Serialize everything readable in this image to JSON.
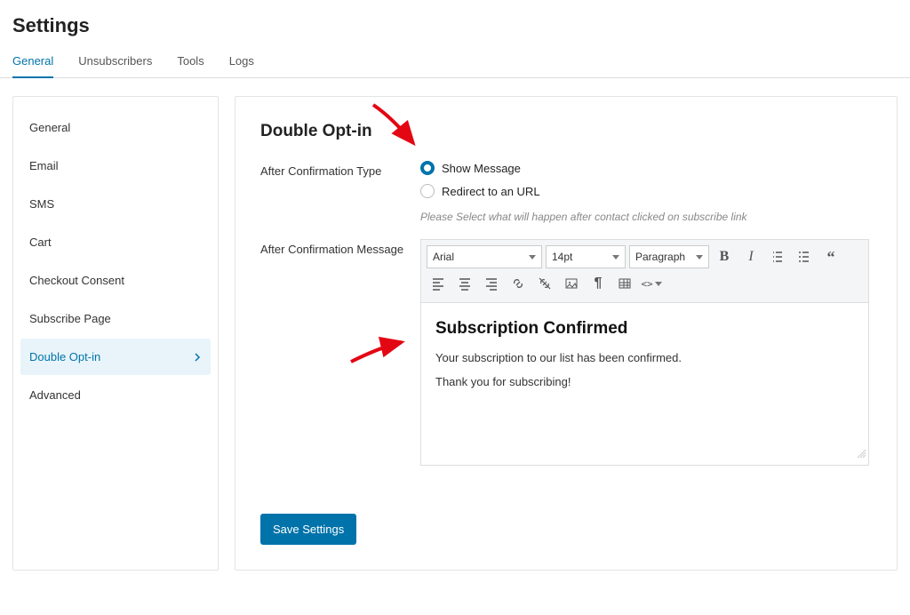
{
  "page_title": "Settings",
  "tabs": {
    "general": "General",
    "unsubscribers": "Unsubscribers",
    "tools": "Tools",
    "logs": "Logs",
    "active": "general"
  },
  "sidebar": {
    "items": {
      "general": "General",
      "email": "Email",
      "sms": "SMS",
      "cart": "Cart",
      "checkout_consent": "Checkout Consent",
      "subscribe_page": "Subscribe Page",
      "double_opt_in": "Double Opt-in",
      "advanced": "Advanced"
    },
    "active": "double_opt_in"
  },
  "section_title": "Double Opt-in",
  "after_confirmation_type": {
    "label": "After Confirmation Type",
    "options": {
      "show_message": "Show Message",
      "redirect": "Redirect to an URL"
    },
    "selected": "show_message",
    "help": "Please Select what will happen after contact clicked on subscribe link"
  },
  "after_confirmation_message": {
    "label": "After Confirmation Message",
    "toolbar": {
      "font": "Arial",
      "size": "14pt",
      "block": "Paragraph",
      "code_label": "<>"
    },
    "content": {
      "heading": "Subscription Confirmed",
      "line1": "Your subscription to our list has been confirmed.",
      "line2": "Thank you for subscribing!"
    }
  },
  "save_button": "Save Settings"
}
